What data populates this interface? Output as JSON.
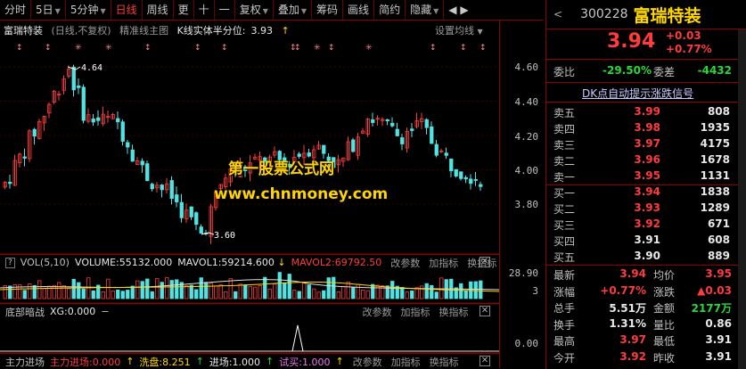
{
  "toolbar": {
    "items": [
      "分时",
      "5日",
      "5分钟",
      "日线",
      "周线",
      "更",
      "十",
      "一",
      "复权",
      "叠加",
      "筹码",
      "画线",
      "简约",
      "隐藏"
    ],
    "active_index": 3,
    "carets": [
      false,
      true,
      true,
      false,
      false,
      false,
      false,
      false,
      true,
      true,
      false,
      false,
      false,
      true
    ]
  },
  "chart": {
    "stock_name": "富瑞特装",
    "period_label": "(日线,不复权)",
    "indicator_label": "精准线主图",
    "kline_label": "K线实体半分位:",
    "kline_value": "3.93",
    "settings_label": "设置均线",
    "high_label": "4.64",
    "low_label": "3.60",
    "price_ticks": [
      "4.60",
      "4.40",
      "4.20",
      "4.00",
      "3.80"
    ],
    "vol_ticks": [
      "28.90",
      "3"
    ],
    "bottom_tick": "0.00",
    "watermark_line1": "第一股票公式网",
    "watermark_line2": "www.chnmoney.com"
  },
  "vol_panel": {
    "name": "VOL(5,10)",
    "volume_label": "VOLUME:",
    "volume_value": "55132.000",
    "mavol1_label": "MAVOL1:",
    "mavol1_value": "59214.600",
    "mavol2_label": "MAVOL2:",
    "mavol2_value": "69792.50",
    "btn_change_param": "改参数",
    "btn_add_indicator": "加指标",
    "btn_switch_indicator": "换指标"
  },
  "signal_panel": {
    "name": "底部暗战",
    "xg_label": "XG:0.000",
    "btn_change_param": "改参数",
    "btn_add_indicator": "加指标",
    "btn_switch_indicator": "换指标"
  },
  "bottom_panel": {
    "name": "主力进场",
    "item1": "主力进场:0.000",
    "item2": "洗盘:8.251",
    "item3": "进场:1.000",
    "item4": "试买:1.000",
    "btn_change_param": "改参数",
    "btn_add_indicator": "加指标",
    "btn_switch_indicator": "换指标"
  },
  "quote": {
    "code": "300228",
    "name": "富瑞特装",
    "price": "3.94",
    "change": "+0.03",
    "change_pct": "+0.77%",
    "weibi_label": "委比",
    "weibi_value": "-29.50%",
    "weicha_label": "委差",
    "weicha_value": "-4432",
    "signal_label": "DK点自动提示涨跌信号",
    "asks": [
      {
        "label": "卖五",
        "price": "3.99",
        "vol": "808"
      },
      {
        "label": "卖四",
        "price": "3.98",
        "vol": "1935"
      },
      {
        "label": "卖三",
        "price": "3.97",
        "vol": "4175"
      },
      {
        "label": "卖二",
        "price": "3.96",
        "vol": "1678"
      },
      {
        "label": "卖一",
        "price": "3.95",
        "vol": "1131"
      }
    ],
    "bids": [
      {
        "label": "买一",
        "price": "3.94",
        "vol": "1838"
      },
      {
        "label": "买二",
        "price": "3.93",
        "vol": "1289"
      },
      {
        "label": "买三",
        "price": "3.92",
        "vol": "671"
      },
      {
        "label": "买四",
        "price": "3.91",
        "vol": "608"
      },
      {
        "label": "买五",
        "price": "3.90",
        "vol": "889"
      }
    ],
    "stats": [
      {
        "l1": "最新",
        "v1": "3.94",
        "c1": "up",
        "l2": "均价",
        "v2": "3.95",
        "c2": "up"
      },
      {
        "l1": "涨幅",
        "v1": "+0.77%",
        "c1": "up",
        "l2": "涨跌",
        "v2": "▲0.03",
        "c2": "up"
      },
      {
        "l1": "总手",
        "v1": "5.51万",
        "c1": "white",
        "l2": "金额",
        "v2": "2177万",
        "c2": "down"
      },
      {
        "l1": "换手",
        "v1": "1.31%",
        "c1": "white",
        "l2": "量比",
        "v2": "0.86",
        "c2": "white"
      },
      {
        "l1": "最高",
        "v1": "3.97",
        "c1": "up",
        "l2": "最低",
        "v2": "3.91",
        "c2": "white"
      },
      {
        "l1": "今开",
        "v1": "3.92",
        "c1": "up",
        "l2": "昨收",
        "v2": "3.91",
        "c2": "white"
      }
    ]
  }
}
